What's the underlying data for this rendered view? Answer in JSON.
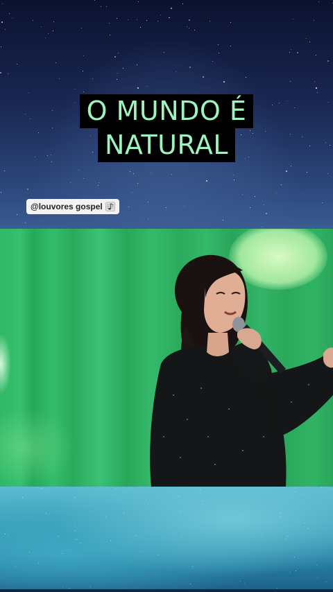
{
  "caption": {
    "line1": "O MUNDO É",
    "line2": "NATURAL",
    "text_color": "#9ef4bf",
    "box_color": "#000000"
  },
  "handle": {
    "text": "@louvores gospel",
    "icon": "music-note-icon"
  },
  "colors": {
    "sky_top": "#0b1230",
    "sky_bottom": "#3a5d92",
    "stage_green": "#2fb866",
    "bottom_teal": "#3598b4"
  }
}
